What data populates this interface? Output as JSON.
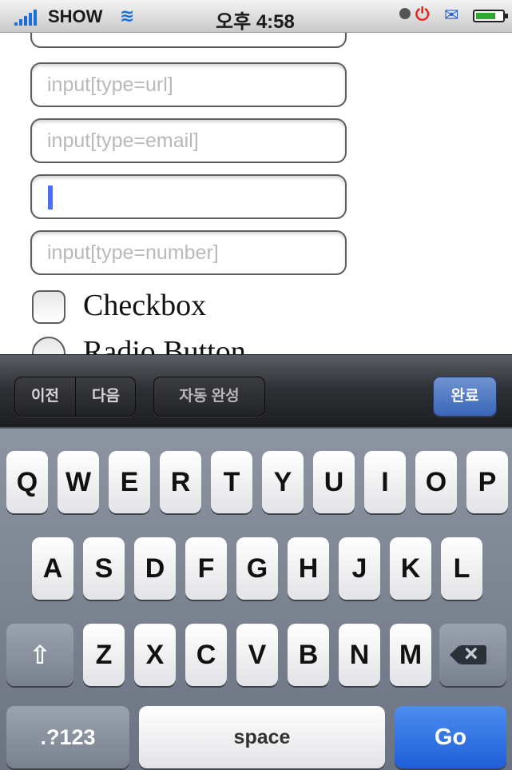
{
  "status_bar": {
    "carrier": "SHOW",
    "time": "오후 4:58"
  },
  "form": {
    "url_placeholder": "input[type=url]",
    "email_placeholder": "input[type=email]",
    "number_placeholder": "input[type=number]",
    "checkbox_label": "Checkbox",
    "radio_label": "Radio Button"
  },
  "accessory_bar": {
    "prev_label": "이전",
    "next_label": "다음",
    "autofill_label": "자동 완성",
    "done_label": "완료"
  },
  "keyboard": {
    "row1": [
      "Q",
      "W",
      "E",
      "R",
      "T",
      "Y",
      "U",
      "I",
      "O",
      "P"
    ],
    "row2": [
      "A",
      "S",
      "D",
      "F",
      "G",
      "H",
      "J",
      "K",
      "L"
    ],
    "row3": [
      "Z",
      "X",
      "C",
      "V",
      "B",
      "N",
      "M"
    ],
    "numbers_label": ".?123",
    "space_label": "space",
    "go_label": "Go"
  }
}
